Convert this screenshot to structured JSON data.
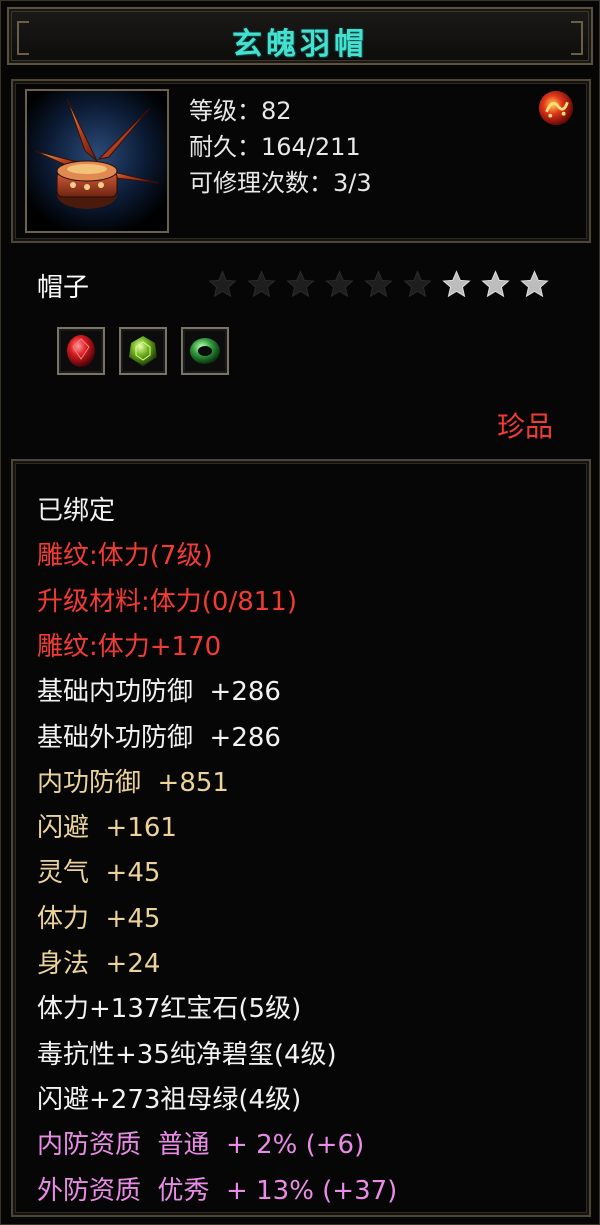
{
  "item": {
    "name": "玄魄羽帽",
    "level_line": "等级：82",
    "durability_line": "耐久：164/211",
    "repair_line": "可修理次数：3/3",
    "type": "帽子",
    "rarity": "珍品",
    "stars_total": 9,
    "stars_lit": 3,
    "gems": [
      "ruby-gem-icon",
      "peridot-gem-icon",
      "jade-ring-gem-icon"
    ],
    "icon": "feathered-hat-icon",
    "seal_icon": "red-seal-icon"
  },
  "attributes": [
    {
      "text": "已绑定",
      "color": "white"
    },
    {
      "text": "雕纹:体力(7级)",
      "color": "red"
    },
    {
      "text": "升级材料:体力(0/811)",
      "color": "red"
    },
    {
      "text": "雕纹:体力+170",
      "color": "red"
    },
    {
      "text": "基础内功防御  +286",
      "color": "white"
    },
    {
      "text": "基础外功防御  +286",
      "color": "white"
    },
    {
      "text": "内功防御  +851",
      "color": "gold"
    },
    {
      "text": "闪避  +161",
      "color": "gold"
    },
    {
      "text": "灵气  +45",
      "color": "gold"
    },
    {
      "text": "体力  +45",
      "color": "gold"
    },
    {
      "text": "身法  +24",
      "color": "gold"
    },
    {
      "text": "体力+137红宝石(5级)",
      "color": "white"
    },
    {
      "text": "毒抗性+35纯净碧玺(4级)",
      "color": "white"
    },
    {
      "text": "闪避+273祖母绿(4级)",
      "color": "white"
    },
    {
      "text": "内防资质  普通  + 2% (+6)",
      "color": "pink"
    },
    {
      "text": "外防资质  优秀  + 13% (+37)",
      "color": "pink"
    }
  ],
  "colors": {
    "title": "#46e0d0",
    "white": "#f2f2f2",
    "red": "#f23b35",
    "gold": "#ecd39a",
    "pink": "#e98ce6"
  }
}
